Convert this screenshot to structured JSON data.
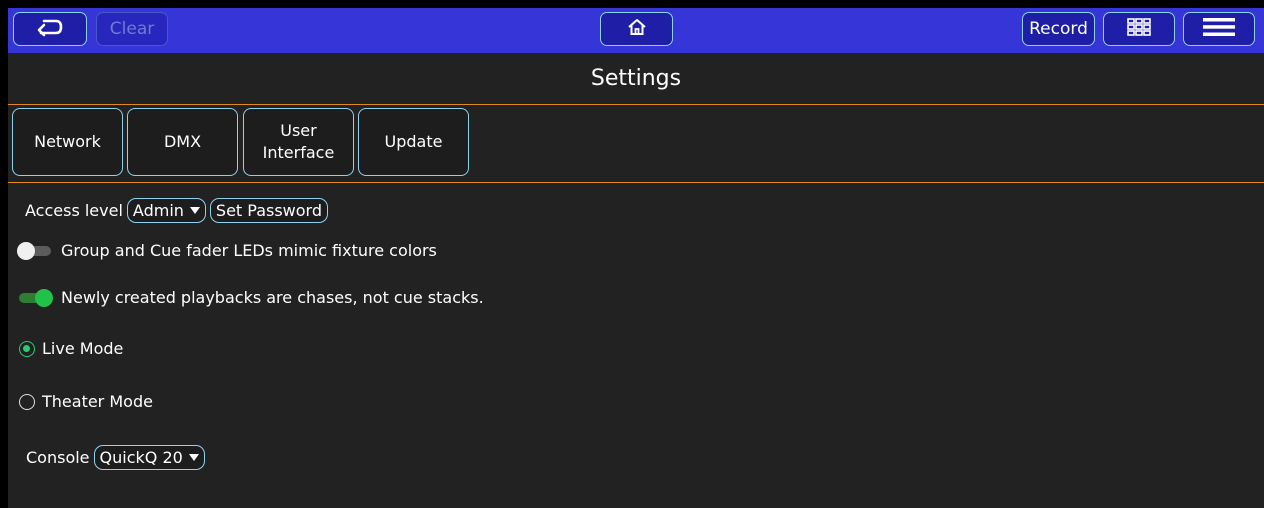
{
  "topbar": {
    "back_icon": "return-arrow-icon",
    "clear_label": "Clear",
    "home_icon": "home-icon",
    "record_label": "Record",
    "grid_icon": "grid-icon",
    "menu_icon": "hamburger-menu-icon"
  },
  "page": {
    "title": "Settings"
  },
  "tabs": [
    {
      "label": "Network"
    },
    {
      "label": "DMX"
    },
    {
      "label": "User\nInterface"
    },
    {
      "label": "Update"
    }
  ],
  "settings": {
    "access_level_label": "Access level",
    "access_level_value": "Admin",
    "set_password_label": "Set Password",
    "fader_leds_label": "Group and Cue fader LEDs mimic fixture colors",
    "fader_leds_enabled": false,
    "chases_label": "Newly created playbacks are chases, not cue stacks.",
    "chases_enabled": true,
    "mode_options": [
      {
        "label": "Live Mode",
        "selected": true
      },
      {
        "label": "Theater Mode",
        "selected": false
      }
    ],
    "console_label": "Console",
    "console_value": "QuickQ 20"
  },
  "colors": {
    "topbar_bg": "#3535d8",
    "panel_bg": "#222222",
    "button_border": "#8ed3ee",
    "divider": "#e08a1e",
    "toggle_on": "#21c247",
    "radio_on": "#2ecc71"
  }
}
